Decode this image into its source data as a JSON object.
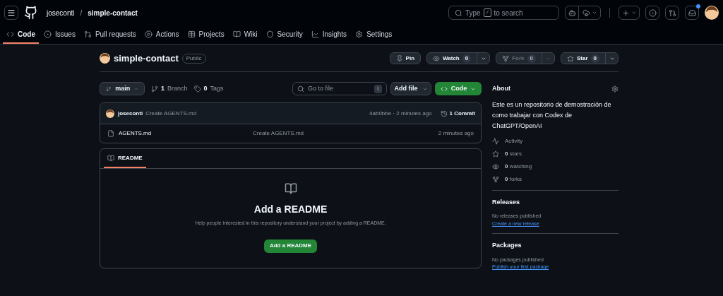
{
  "header": {
    "owner": "joseconti",
    "separator": "/",
    "repo": "simple-contact",
    "search": {
      "prefix": "Type",
      "key": "/",
      "suffix": "to search"
    },
    "notifications": {
      "unread": true
    }
  },
  "tabs": [
    {
      "label": "Code",
      "selected": true
    },
    {
      "label": "Issues",
      "selected": false
    },
    {
      "label": "Pull requests",
      "selected": false
    },
    {
      "label": "Actions",
      "selected": false
    },
    {
      "label": "Projects",
      "selected": false
    },
    {
      "label": "Wiki",
      "selected": false
    },
    {
      "label": "Security",
      "selected": false
    },
    {
      "label": "Insights",
      "selected": false
    },
    {
      "label": "Settings",
      "selected": false
    }
  ],
  "repo_header": {
    "name": "simple-contact",
    "visibility": "Public",
    "actions": [
      {
        "label": "Pin",
        "disabled": false
      },
      {
        "label": "Watch",
        "count": "0",
        "disabled": false
      },
      {
        "label": "Fork",
        "count": "0",
        "disabled": true
      },
      {
        "label": "Star",
        "count": "0",
        "disabled": false
      }
    ]
  },
  "toolbar": {
    "branch": "main",
    "branches": {
      "count": "1",
      "label": "Branch"
    },
    "tags": {
      "count": "0",
      "label": "Tags"
    },
    "file_search": {
      "placeholder": "Go to file",
      "key": "t"
    },
    "add_file": "Add file",
    "code": "Code"
  },
  "latest_commit": {
    "author": "joseconti",
    "message": "Create AGENTS.md",
    "hash_time": "4ab0bbe · 2 minutes ago",
    "commits": "1 Commit"
  },
  "files": [
    {
      "name": "AGENTS.md",
      "message": "Create AGENTS.md",
      "time": "2 minutes ago"
    }
  ],
  "readme": {
    "tab": "README",
    "title": "Add a README",
    "text": "Help people interested in this repository understand your project by adding a README.",
    "button": "Add a README"
  },
  "about": {
    "title": "About",
    "description": "Este es un repositorio de demostración de como trabajar con Codex de ChatGPT/OpenAI",
    "stats": [
      {
        "label": "Activity"
      },
      {
        "count": "0",
        "label": "stars"
      },
      {
        "count": "0",
        "label": "watching"
      },
      {
        "count": "0",
        "label": "forks"
      }
    ]
  },
  "releases": {
    "title": "Releases",
    "text": "No releases published",
    "link": "Create a new release"
  },
  "packages": {
    "title": "Packages",
    "text": "No packages published",
    "link": "Publish your first package"
  }
}
